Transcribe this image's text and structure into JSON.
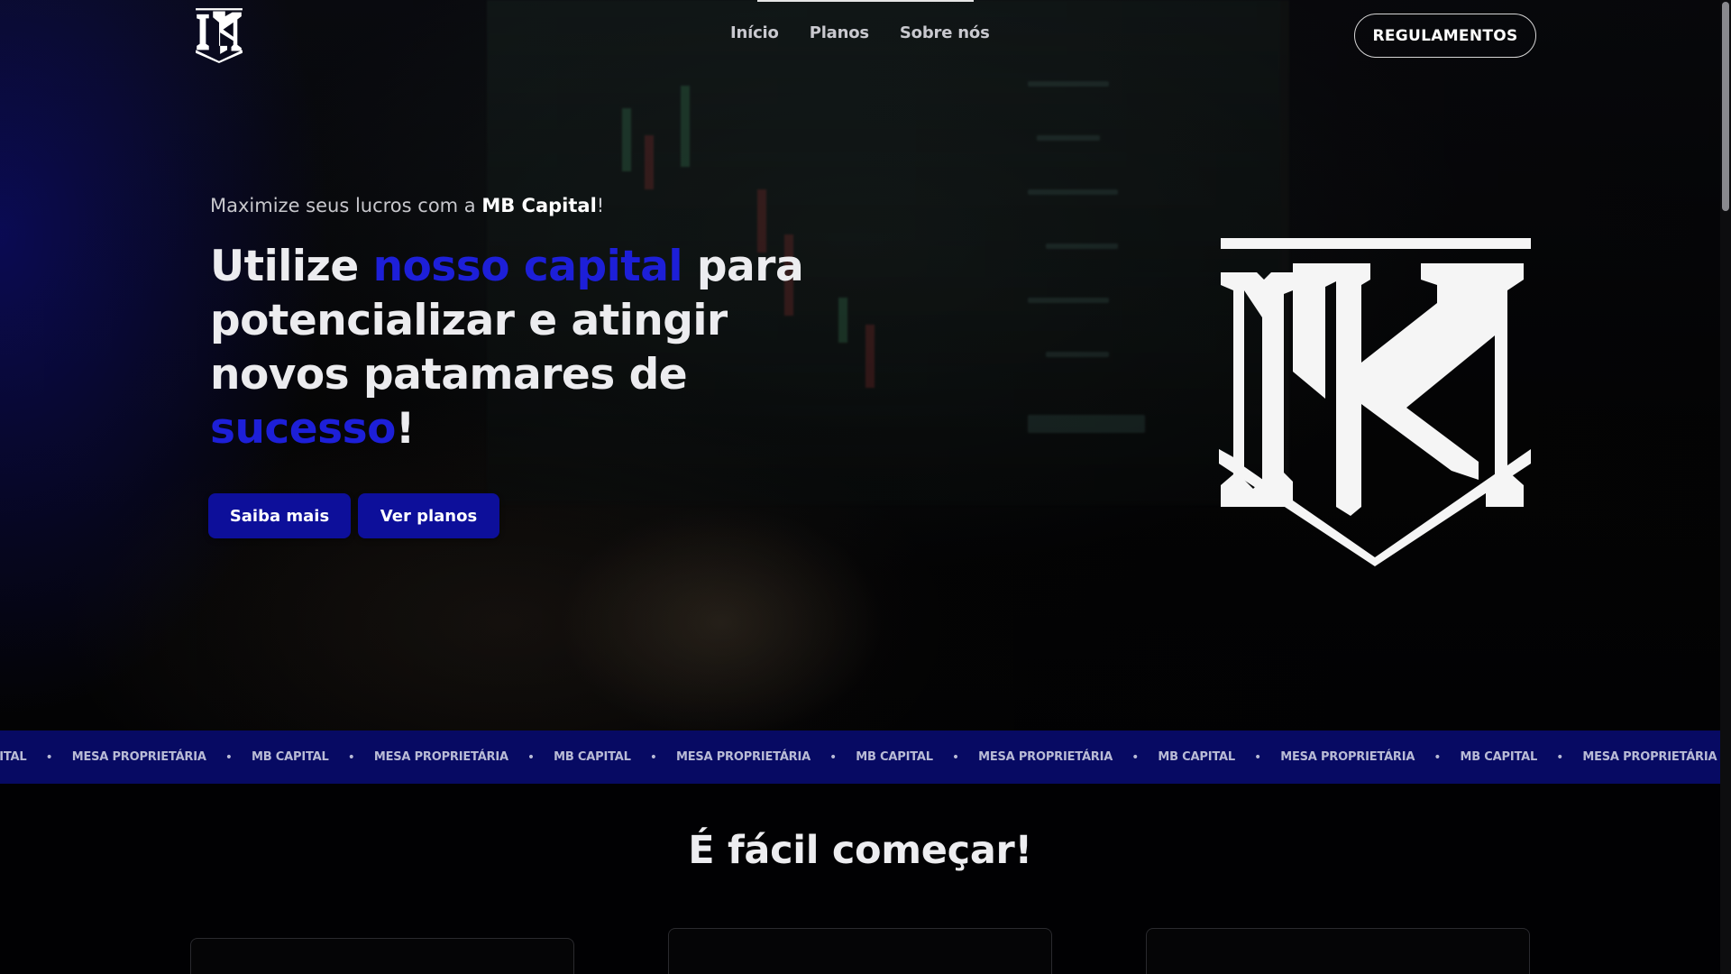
{
  "brand": {
    "logo_text": "MB",
    "accent_color": "#1d1fd8",
    "button_color": "#0d0f9a",
    "marquee_color": "#070a63"
  },
  "nav": {
    "items": [
      {
        "label": "Início"
      },
      {
        "label": "Planos"
      },
      {
        "label": "Sobre nós"
      }
    ],
    "cta_label": "REGULAMENTOS"
  },
  "hero": {
    "tagline_prefix": "Maximize seus lucros com a ",
    "tagline_brand": "MB Capital",
    "tagline_suffix": "!",
    "headline": {
      "part1": "Utilize ",
      "accent1": "nosso capital",
      "part2": " para potencializar e atingir novos patamares de ",
      "accent2": "sucesso",
      "part3": "!"
    },
    "buttons": {
      "more": "Saiba mais",
      "plans": "Ver planos"
    }
  },
  "marquee": {
    "items": [
      "APITAL",
      "MESA PROPRIETÁRIA",
      "MB CAPITAL",
      "MESA PROPRIETÁRIA",
      "MB CAPITAL",
      "MESA PROPRIETÁRIA",
      "MB CAPITAL",
      "MESA PROPRIETÁRIA",
      "MB CAPITAL",
      "MESA PROPRIETÁRIA",
      "MB CAPITAL",
      "MESA PROPRIETÁRIA"
    ],
    "separator": "•"
  },
  "section": {
    "title": "É fácil começar!"
  }
}
